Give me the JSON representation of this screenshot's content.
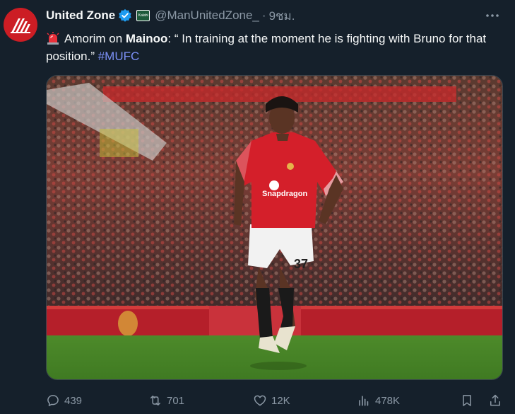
{
  "tweet": {
    "display_name": "United Zone",
    "handle": "@ManUnitedZone_",
    "separator": "·",
    "time": "9ชม.",
    "affiliate_badge_text": "Kalahi",
    "text_part1": "Amorim on ",
    "text_bold": "Mainoo",
    "text_part2": ": “ In training at the moment he is fighting with Bruno for that position.” ",
    "hashtag": "#MUFC",
    "media_shirt_sponsor": "Snapdragon",
    "media_shorts_number": "37"
  },
  "actions": {
    "replies": "439",
    "reposts": "701",
    "likes": "12K",
    "views": "478K"
  },
  "icons": {
    "avatar": "united-zone-logo-icon",
    "verified": "verified-badge-icon",
    "affiliate": "affiliate-flag-icon",
    "more": "more-dots-icon",
    "siren": "siren-emoji-icon",
    "reply": "reply-icon",
    "repost": "repost-icon",
    "like": "heart-icon",
    "views": "views-chart-icon",
    "bookmark": "bookmark-icon",
    "share": "share-icon"
  },
  "colors": {
    "background": "#15202b",
    "primary_text": "#f7f9f9",
    "secondary_text": "#8b98a5",
    "hashtag": "#7b8ff5",
    "verified": "#1d9bf0",
    "avatar_red": "#cc1d24"
  }
}
